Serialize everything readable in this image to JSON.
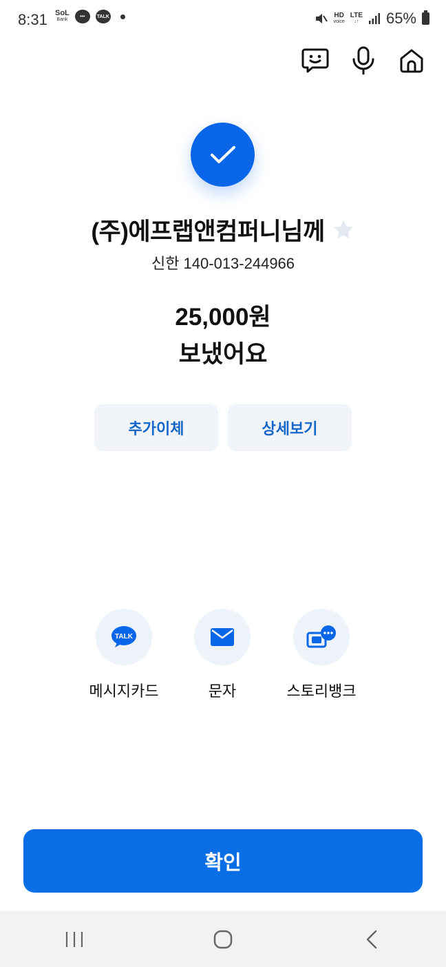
{
  "status_bar": {
    "time": "8:31",
    "sol_label": "SoL",
    "sol_sub": "Bank",
    "talk_label": "TALK",
    "hd_label": "HD",
    "voice_label": "voice",
    "lte_label": "LTE",
    "battery_percent": "65%"
  },
  "header": {
    "icons": [
      "chatbot-icon",
      "microphone-icon",
      "home-icon"
    ]
  },
  "result": {
    "recipient_name": "(주)에프랩앤컴퍼니님께",
    "account": "신한 140-013-244966",
    "amount": "25,000원",
    "message": "보냈어요"
  },
  "actions": {
    "add_transfer": "추가이체",
    "details": "상세보기"
  },
  "share": {
    "kakao_badge": "TALK",
    "items": [
      "메시지카드",
      "문자",
      "스토리뱅크"
    ]
  },
  "footer": {
    "confirm": "확인"
  },
  "colors": {
    "primary": "#0a6ee6",
    "button_bg": "#f1f5fa",
    "button_text": "#1466c8"
  }
}
